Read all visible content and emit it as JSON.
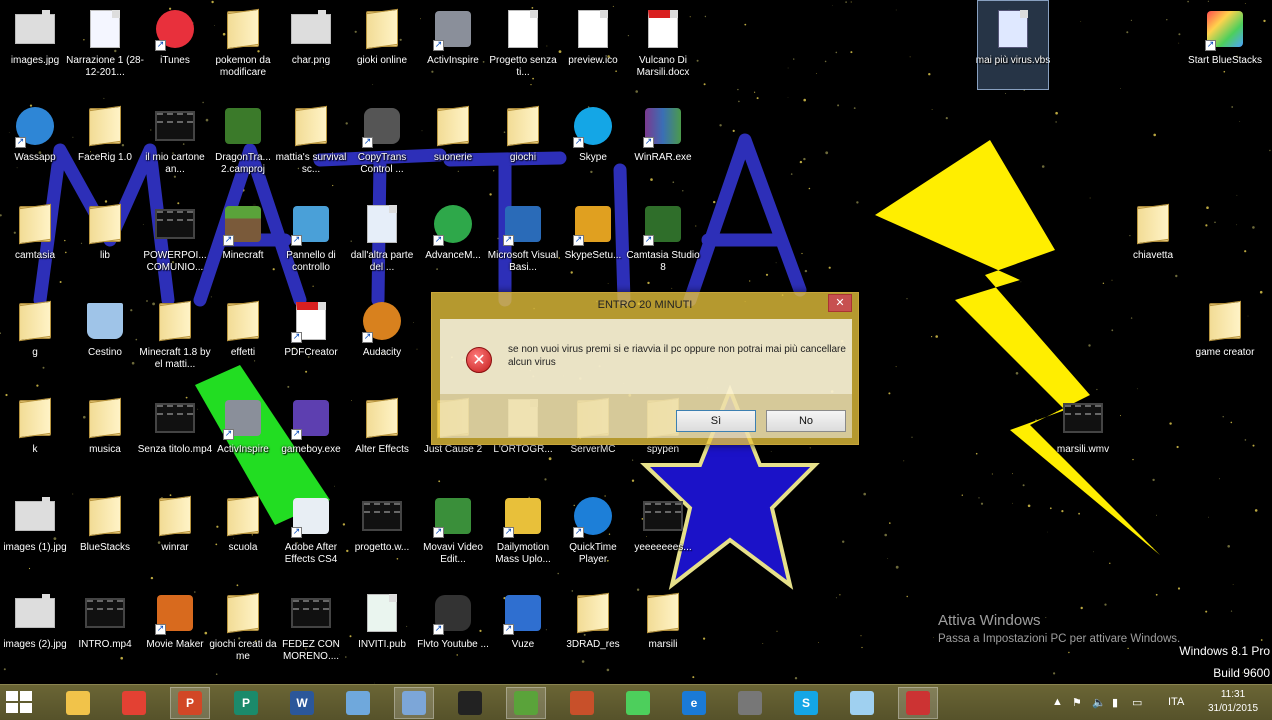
{
  "desktop": {
    "icons": [
      {
        "label": "images.jpg",
        "type": "image-icon"
      },
      {
        "label": "Narrazione 1 (28-12-201...",
        "type": "wma-file-icon"
      },
      {
        "label": "iTunes",
        "type": "itunes-icon"
      },
      {
        "label": "pokemon da modificare",
        "type": "folder-icon"
      },
      {
        "label": "char.png",
        "type": "image-icon"
      },
      {
        "label": "gioki online",
        "type": "folder-icon"
      },
      {
        "label": "ActivInspire",
        "type": "activinspire-icon"
      },
      {
        "label": "Progetto senza ti...",
        "type": "document-icon"
      },
      {
        "label": "preview.ico",
        "type": "document-icon"
      },
      {
        "label": "Vulcano Di Marsili.docx",
        "type": "pdf-document-icon"
      },
      {
        "label": "mai più virus.vbs",
        "type": "vbs-script-icon"
      },
      {
        "label": "Start BlueStacks",
        "type": "bluestacks-icon"
      },
      {
        "label": "Wassapp",
        "type": "chat-app-icon"
      },
      {
        "label": "FaceRig 1.0",
        "type": "folder-icon"
      },
      {
        "label": "il mio cartone an...",
        "type": "video-file-icon"
      },
      {
        "label": "DragonTra... 2.camproj",
        "type": "camtasia-project-icon"
      },
      {
        "label": "mattia's survival sc...",
        "type": "folder-icon"
      },
      {
        "label": "CopyTrans Control ...",
        "type": "copytrans-icon"
      },
      {
        "label": "suonerie",
        "type": "folder-icon"
      },
      {
        "label": "giochi",
        "type": "folder-icon"
      },
      {
        "label": "Skype",
        "type": "skype-icon"
      },
      {
        "label": "WinRAR.exe",
        "type": "winrar-icon"
      },
      {
        "label": "camtasia",
        "type": "folder-icon"
      },
      {
        "label": "lib",
        "type": "folder-icon"
      },
      {
        "label": "POWERPOI... COMUNIO...",
        "type": "video-file-icon"
      },
      {
        "label": "Minecraft",
        "type": "minecraft-icon"
      },
      {
        "label": "Pannello di controllo",
        "type": "control-panel-icon"
      },
      {
        "label": "dall'altra parte del ...",
        "type": "audio-file-icon"
      },
      {
        "label": "AdvanceM...",
        "type": "advance-icon"
      },
      {
        "label": "Microsoft Visual Basi...",
        "type": "visual-basic-icon"
      },
      {
        "label": "SkypeSetu...",
        "type": "installer-icon"
      },
      {
        "label": "Camtasia Studio 8",
        "type": "camtasia-icon"
      },
      {
        "label": "chiavetta",
        "type": "folder-icon"
      },
      {
        "label": "g",
        "type": "folder-icon"
      },
      {
        "label": "Cestino",
        "type": "recycle-bin-icon"
      },
      {
        "label": "Minecraft 1.8 by el matti...",
        "type": "folder-icon"
      },
      {
        "label": "effetti",
        "type": "folder-icon"
      },
      {
        "label": "PDFCreator",
        "type": "pdf-creator-icon"
      },
      {
        "label": "Audacity",
        "type": "audacity-icon"
      },
      {
        "label": "game creator",
        "type": "folder-icon"
      },
      {
        "label": "k",
        "type": "folder-icon"
      },
      {
        "label": "musica",
        "type": "folder-icon"
      },
      {
        "label": "Senza titolo.mp4",
        "type": "video-file-icon"
      },
      {
        "label": "ActivInspire",
        "type": "activinspire-icon"
      },
      {
        "label": "gameboy.exe",
        "type": "gameboy-icon"
      },
      {
        "label": "Alter Effects",
        "type": "folder-icon"
      },
      {
        "label": "Just Cause 2",
        "type": "folder-icon"
      },
      {
        "label": "L'ORTOGR...",
        "type": "document-icon"
      },
      {
        "label": "ServerMC",
        "type": "folder-icon"
      },
      {
        "label": "spypen",
        "type": "folder-icon"
      },
      {
        "label": "marsili.wmv",
        "type": "video-file-icon"
      },
      {
        "label": "images (1).jpg",
        "type": "image-icon"
      },
      {
        "label": "BlueStacks",
        "type": "folder-icon"
      },
      {
        "label": "winrar",
        "type": "folder-icon"
      },
      {
        "label": "scuola",
        "type": "folder-icon"
      },
      {
        "label": "Adobe After Effects CS4",
        "type": "after-effects-icon"
      },
      {
        "label": "progetto.w...",
        "type": "video-file-icon"
      },
      {
        "label": "Movavi Video Edit...",
        "type": "movavi-icon"
      },
      {
        "label": "Dailymotion Mass Uplo...",
        "type": "dailymotion-icon"
      },
      {
        "label": "QuickTime Player",
        "type": "quicktime-icon"
      },
      {
        "label": "yeeeeeees...",
        "type": "video-file-icon"
      },
      {
        "label": "images (2).jpg",
        "type": "image-icon"
      },
      {
        "label": "INTRO.mp4",
        "type": "video-file-icon"
      },
      {
        "label": "Movie Maker",
        "type": "movie-maker-icon"
      },
      {
        "label": "giochi creati da me",
        "type": "folder-icon"
      },
      {
        "label": "FEDEZ CON MORENO....",
        "type": "video-file-icon"
      },
      {
        "label": "INVITI.pub",
        "type": "publisher-file-icon"
      },
      {
        "label": "Flvto Youtube ...",
        "type": "flvto-icon"
      },
      {
        "label": "Vuze",
        "type": "vuze-icon"
      },
      {
        "label": "3DRAD_res",
        "type": "folder-icon"
      },
      {
        "label": "marsili",
        "type": "folder-icon"
      }
    ],
    "wallpaper_text": "MATTIA"
  },
  "dialog": {
    "title": "ENTRO 20 MINUTI",
    "message": "se non vuoi virus premi si e riavvia il pc oppure non potrai mai più cancellare alcun virus",
    "yes_label": "Sì",
    "no_label": "No",
    "close_label": "✕"
  },
  "watermark": {
    "line1": "Attiva Windows",
    "line2": "Passa a Impostazioni PC per attivare Windows."
  },
  "edition": {
    "line1": "Windows 8.1 Pro",
    "line2": "Build 9600"
  },
  "taskbar": {
    "items": [
      {
        "name": "file-explorer-icon",
        "label": ""
      },
      {
        "name": "chrome-icon",
        "label": ""
      },
      {
        "name": "powerpoint-icon",
        "label": "P"
      },
      {
        "name": "publisher-icon",
        "label": "P"
      },
      {
        "name": "word-icon",
        "label": "W"
      },
      {
        "name": "paint-icon",
        "label": ""
      },
      {
        "name": "activinspire-icon",
        "label": ""
      },
      {
        "name": "flvto-icon",
        "label": ""
      },
      {
        "name": "minecraft-icon",
        "label": ""
      },
      {
        "name": "toolbox-icon",
        "label": ""
      },
      {
        "name": "bluestacks-icon",
        "label": ""
      },
      {
        "name": "internet-explorer-icon",
        "label": "e"
      },
      {
        "name": "disk-icon",
        "label": ""
      },
      {
        "name": "skype-icon",
        "label": "S"
      },
      {
        "name": "notepad-icon",
        "label": ""
      },
      {
        "name": "script-host-icon",
        "label": ""
      }
    ],
    "tray": {
      "language": "ITA",
      "time": "11:31",
      "date": "31/01/2015"
    }
  },
  "colors": {
    "dialog_bg": "#e8c43c",
    "lightning": "#ffee00",
    "star_fill": "#1b12c8",
    "wallpaper_text": "#2d2fb8",
    "green_arrow": "#22dd22",
    "taskbar": "#5f5a2f"
  }
}
